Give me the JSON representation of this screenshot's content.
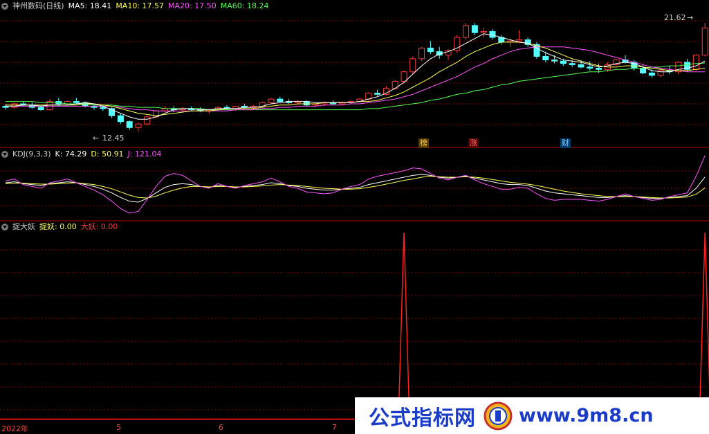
{
  "header": {
    "stock_name": "神州数码(日线)",
    "ma5_label": "MA5: 18.41",
    "ma10_label": "MA10: 17.57",
    "ma20_label": "MA20: 17.50",
    "ma60_label": "MA60: 18.24"
  },
  "kdj_header": {
    "name": "KDJ(9,3,3)",
    "k_label": "K: 74.29",
    "d_label": "D: 50.91",
    "j_label": "J: 121.04"
  },
  "ind_header": {
    "name": "捉大妖",
    "v1_label": "捉妖: 0.00",
    "v2_label": "大妖: 0.00"
  },
  "annotations": {
    "high_label": "21.62",
    "low_label": "12.45",
    "tag_bang": "榜",
    "tag_zhang": "涨",
    "tag_cai": "财"
  },
  "x_axis": {
    "labels": [
      "2022年",
      "5",
      "6",
      "7"
    ]
  },
  "watermark": {
    "text1": "公式指标网",
    "text2": "www.9m8.cn"
  },
  "colors": {
    "up": "#ff3c3c",
    "down": "#54ffff",
    "ma5": "#ffffff",
    "ma10": "#ffff54",
    "ma20": "#ff54ff",
    "ma60": "#54ff54",
    "grid": "#8b0000",
    "sep": "#c00000",
    "spike": "#ff2020"
  },
  "chart_data": [
    {
      "type": "candlestick",
      "ylim": [
        12.0,
        22.5
      ],
      "note_high": 21.62,
      "note_low": 12.45,
      "ohlc": [
        [
          14.6,
          14.8,
          14.3,
          14.5
        ],
        [
          14.5,
          14.9,
          14.4,
          14.8
        ],
        [
          14.8,
          15.0,
          14.6,
          14.7
        ],
        [
          14.7,
          14.9,
          14.4,
          14.5
        ],
        [
          14.5,
          14.7,
          14.2,
          14.3
        ],
        [
          14.3,
          15.2,
          14.2,
          15.0
        ],
        [
          15.0,
          15.3,
          14.6,
          14.8
        ],
        [
          14.8,
          15.1,
          14.6,
          15.0
        ],
        [
          15.0,
          15.3,
          14.8,
          14.9
        ],
        [
          14.9,
          15.0,
          14.5,
          14.6
        ],
        [
          14.6,
          14.8,
          14.3,
          14.5
        ],
        [
          14.5,
          14.7,
          14.2,
          14.4
        ],
        [
          14.4,
          14.5,
          13.6,
          13.8
        ],
        [
          13.8,
          14.0,
          13.1,
          13.3
        ],
        [
          13.3,
          13.4,
          12.6,
          12.8
        ],
        [
          12.8,
          13.2,
          12.45,
          13.1
        ],
        [
          13.1,
          13.8,
          13.0,
          13.7
        ],
        [
          13.7,
          14.3,
          13.6,
          14.2
        ],
        [
          14.2,
          14.6,
          14.0,
          14.4
        ],
        [
          14.4,
          14.6,
          14.1,
          14.3
        ],
        [
          14.3,
          14.5,
          14.1,
          14.4
        ],
        [
          14.4,
          14.6,
          14.2,
          14.3
        ],
        [
          14.3,
          14.5,
          14.1,
          14.2
        ],
        [
          14.2,
          14.4,
          14.0,
          14.3
        ],
        [
          14.3,
          14.6,
          14.2,
          14.5
        ],
        [
          14.5,
          14.7,
          14.3,
          14.4
        ],
        [
          14.4,
          14.6,
          14.2,
          14.6
        ],
        [
          14.6,
          14.8,
          14.4,
          14.5
        ],
        [
          14.5,
          14.7,
          14.3,
          14.6
        ],
        [
          14.6,
          15.0,
          14.5,
          14.9
        ],
        [
          14.9,
          15.3,
          14.8,
          15.2
        ],
        [
          15.2,
          15.4,
          14.9,
          15.0
        ],
        [
          15.0,
          15.2,
          14.8,
          14.9
        ],
        [
          14.9,
          15.1,
          14.7,
          15.0
        ],
        [
          15.0,
          15.1,
          14.6,
          14.7
        ],
        [
          14.7,
          14.9,
          14.5,
          14.8
        ],
        [
          14.8,
          15.0,
          14.6,
          14.9
        ],
        [
          14.9,
          15.1,
          14.7,
          14.8
        ],
        [
          14.8,
          15.0,
          14.7,
          14.9
        ],
        [
          14.9,
          15.1,
          14.8,
          15.0
        ],
        [
          15.0,
          15.3,
          14.9,
          15.2
        ],
        [
          15.2,
          15.8,
          15.1,
          15.7
        ],
        [
          15.7,
          16.0,
          15.5,
          15.6
        ],
        [
          15.6,
          16.3,
          15.5,
          16.1
        ],
        [
          16.1,
          16.8,
          16.0,
          16.7
        ],
        [
          16.7,
          17.6,
          16.5,
          17.5
        ],
        [
          17.5,
          18.8,
          17.3,
          18.6
        ],
        [
          18.6,
          19.6,
          18.4,
          19.5
        ],
        [
          19.5,
          20.1,
          19.0,
          19.2
        ],
        [
          19.2,
          19.6,
          18.6,
          18.9
        ],
        [
          18.9,
          19.4,
          18.5,
          19.3
        ],
        [
          19.3,
          20.6,
          19.1,
          20.4
        ],
        [
          20.4,
          21.6,
          20.2,
          21.4
        ],
        [
          21.4,
          21.6,
          20.6,
          20.8
        ],
        [
          20.8,
          21.2,
          20.4,
          20.9
        ],
        [
          20.9,
          21.1,
          20.2,
          20.4
        ],
        [
          20.4,
          20.6,
          19.8,
          20.0
        ],
        [
          20.0,
          20.3,
          19.6,
          20.1
        ],
        [
          20.1,
          21.0,
          19.9,
          20.2
        ],
        [
          20.2,
          20.4,
          19.6,
          19.8
        ],
        [
          19.8,
          20.0,
          18.6,
          18.8
        ],
        [
          18.8,
          19.2,
          18.3,
          18.5
        ],
        [
          18.5,
          18.9,
          18.2,
          18.4
        ],
        [
          18.4,
          18.6,
          18.0,
          18.2
        ],
        [
          18.2,
          18.5,
          17.9,
          18.1
        ],
        [
          18.1,
          18.5,
          17.8,
          17.9
        ],
        [
          17.9,
          18.4,
          17.6,
          17.8
        ],
        [
          17.8,
          18.2,
          17.4,
          17.7
        ],
        [
          17.7,
          18.3,
          17.5,
          18.1
        ],
        [
          18.1,
          18.6,
          18.0,
          18.5
        ],
        [
          18.5,
          18.9,
          18.2,
          18.3
        ],
        [
          18.3,
          18.5,
          17.6,
          17.8
        ],
        [
          17.8,
          18.1,
          17.3,
          17.4
        ],
        [
          17.4,
          17.7,
          17.0,
          17.2
        ],
        [
          17.2,
          17.8,
          17.0,
          17.6
        ],
        [
          17.6,
          18.0,
          17.3,
          17.5
        ],
        [
          17.5,
          18.4,
          17.3,
          18.3
        ],
        [
          18.3,
          18.6,
          17.5,
          17.7
        ],
        [
          17.7,
          19.0,
          17.6,
          18.9
        ],
        [
          18.9,
          21.62,
          18.8,
          21.2
        ]
      ],
      "ma5": [
        14.6,
        14.6,
        14.7,
        14.7,
        14.6,
        14.7,
        14.7,
        14.7,
        14.8,
        14.9,
        14.8,
        14.6,
        14.3,
        14.0,
        13.7,
        13.5,
        13.5,
        13.7,
        14.0,
        14.3,
        14.4,
        14.4,
        14.3,
        14.3,
        14.4,
        14.4,
        14.4,
        14.5,
        14.5,
        14.6,
        14.8,
        14.9,
        15.0,
        15.0,
        15.0,
        14.9,
        14.9,
        14.9,
        14.9,
        14.9,
        15.0,
        15.2,
        15.4,
        15.7,
        16.1,
        16.6,
        17.3,
        18.0,
        18.6,
        19.0,
        19.2,
        19.5,
        19.9,
        20.3,
        20.7,
        20.6,
        20.4,
        20.2,
        20.0,
        19.9,
        19.5,
        19.1,
        18.8,
        18.5,
        18.4,
        18.3,
        18.1,
        17.9,
        18.0,
        18.2,
        18.3,
        18.2,
        17.9,
        17.6,
        17.5,
        17.5,
        17.7,
        17.8,
        18.0,
        18.4
      ],
      "ma10": [
        14.7,
        14.7,
        14.7,
        14.7,
        14.7,
        14.7,
        14.7,
        14.7,
        14.7,
        14.8,
        14.8,
        14.7,
        14.6,
        14.4,
        14.2,
        14.0,
        13.9,
        13.8,
        13.9,
        14.0,
        14.1,
        14.2,
        14.2,
        14.2,
        14.3,
        14.4,
        14.4,
        14.4,
        14.4,
        14.5,
        14.6,
        14.7,
        14.7,
        14.8,
        14.8,
        14.8,
        14.9,
        14.9,
        14.9,
        14.9,
        15.0,
        15.0,
        15.1,
        15.3,
        15.5,
        15.8,
        16.2,
        16.6,
        17.0,
        17.5,
        17.9,
        18.3,
        18.8,
        19.2,
        19.5,
        19.8,
        20.0,
        20.0,
        20.0,
        19.9,
        19.7,
        19.5,
        19.2,
        18.9,
        18.6,
        18.4,
        18.2,
        18.0,
        17.9,
        17.9,
        18.0,
        18.0,
        17.9,
        17.8,
        17.7,
        17.6,
        17.6,
        17.6,
        17.7,
        17.8
      ],
      "ma20": [
        14.6,
        14.6,
        14.6,
        14.6,
        14.6,
        14.6,
        14.6,
        14.6,
        14.6,
        14.6,
        14.6,
        14.6,
        14.6,
        14.5,
        14.4,
        14.3,
        14.3,
        14.2,
        14.2,
        14.2,
        14.2,
        14.2,
        14.2,
        14.2,
        14.2,
        14.2,
        14.3,
        14.3,
        14.3,
        14.4,
        14.4,
        14.5,
        14.5,
        14.6,
        14.6,
        14.6,
        14.7,
        14.7,
        14.7,
        14.8,
        14.8,
        14.9,
        15.0,
        15.1,
        15.2,
        15.4,
        15.6,
        15.9,
        16.2,
        16.5,
        16.8,
        17.1,
        17.5,
        17.9,
        18.2,
        18.6,
        18.9,
        19.2,
        19.4,
        19.5,
        19.6,
        19.6,
        19.6,
        19.6,
        19.5,
        19.4,
        19.3,
        19.1,
        18.9,
        18.7,
        18.5,
        18.3,
        18.1,
        17.9,
        17.8,
        17.7,
        17.6,
        17.5,
        17.5,
        17.5
      ],
      "ma60": [
        15.0,
        15.0,
        15.0,
        15.0,
        14.9,
        14.9,
        14.9,
        14.8,
        14.8,
        14.8,
        14.7,
        14.7,
        14.7,
        14.6,
        14.6,
        14.5,
        14.5,
        14.5,
        14.4,
        14.4,
        14.4,
        14.4,
        14.4,
        14.3,
        14.3,
        14.3,
        14.3,
        14.3,
        14.3,
        14.3,
        14.3,
        14.3,
        14.3,
        14.3,
        14.3,
        14.3,
        14.3,
        14.3,
        14.3,
        14.3,
        14.3,
        14.4,
        14.4,
        14.5,
        14.6,
        14.7,
        14.8,
        14.9,
        15.1,
        15.2,
        15.4,
        15.6,
        15.7,
        15.9,
        16.0,
        16.2,
        16.4,
        16.5,
        16.7,
        16.8,
        16.9,
        17.0,
        17.1,
        17.2,
        17.3,
        17.4,
        17.5,
        17.5,
        17.6,
        17.7,
        17.7,
        17.8,
        17.8,
        17.9,
        17.9,
        18.0,
        18.0,
        18.1,
        18.2,
        18.24
      ]
    },
    {
      "type": "line",
      "ylim": [
        -10,
        110
      ],
      "series": [
        {
          "name": "K",
          "values": [
            62,
            64,
            60,
            58,
            56,
            60,
            62,
            64,
            62,
            58,
            54,
            48,
            40,
            30,
            22,
            20,
            28,
            40,
            52,
            58,
            60,
            58,
            54,
            52,
            56,
            54,
            52,
            54,
            56,
            58,
            62,
            60,
            56,
            54,
            50,
            48,
            46,
            46,
            48,
            50,
            52,
            58,
            62,
            66,
            70,
            74,
            78,
            80,
            78,
            74,
            72,
            74,
            76,
            72,
            68,
            64,
            60,
            58,
            58,
            56,
            50,
            44,
            40,
            38,
            36,
            34,
            32,
            30,
            30,
            32,
            34,
            32,
            30,
            28,
            28,
            30,
            32,
            34,
            50,
            74.29
          ]
        },
        {
          "name": "D",
          "values": [
            60,
            61,
            61,
            60,
            59,
            59,
            60,
            61,
            62,
            60,
            58,
            54,
            49,
            42,
            35,
            30,
            29,
            33,
            40,
            46,
            51,
            54,
            54,
            53,
            54,
            54,
            53,
            53,
            54,
            55,
            57,
            58,
            57,
            56,
            54,
            52,
            50,
            49,
            48,
            48,
            49,
            52,
            55,
            59,
            63,
            67,
            70,
            74,
            76,
            75,
            74,
            74,
            75,
            74,
            72,
            69,
            66,
            63,
            61,
            59,
            56,
            52,
            48,
            44,
            41,
            38,
            36,
            34,
            32,
            32,
            32,
            32,
            31,
            30,
            29,
            29,
            30,
            31,
            37,
            50.91
          ]
        },
        {
          "name": "J",
          "values": [
            66,
            70,
            58,
            54,
            50,
            62,
            66,
            70,
            62,
            54,
            46,
            36,
            22,
            6,
            -4,
            0,
            26,
            54,
            76,
            82,
            78,
            66,
            54,
            50,
            60,
            54,
            50,
            56,
            60,
            64,
            72,
            64,
            54,
            50,
            42,
            40,
            38,
            40,
            48,
            54,
            58,
            70,
            76,
            80,
            84,
            88,
            94,
            92,
            82,
            72,
            68,
            74,
            78,
            68,
            60,
            54,
            48,
            48,
            52,
            50,
            38,
            28,
            24,
            26,
            26,
            26,
            24,
            22,
            26,
            32,
            38,
            32,
            28,
            24,
            26,
            32,
            36,
            40,
            76,
            121.04
          ]
        }
      ]
    },
    {
      "type": "line",
      "ylim": [
        0,
        100
      ],
      "series": [
        {
          "name": "捉妖",
          "values": [
            0,
            0,
            0,
            0,
            0,
            0,
            0,
            0,
            0,
            0,
            0,
            0,
            0,
            0,
            0,
            0,
            0,
            0,
            0,
            0,
            0,
            0,
            0,
            0,
            0,
            0,
            0,
            0,
            0,
            0,
            0,
            0,
            0,
            0,
            0,
            0,
            0,
            0,
            0,
            0,
            0,
            0,
            0,
            0,
            0,
            100,
            0,
            0,
            0,
            0,
            0,
            0,
            0,
            0,
            0,
            0,
            0,
            0,
            0,
            0,
            0,
            0,
            0,
            0,
            0,
            0,
            0,
            0,
            0,
            0,
            0,
            0,
            0,
            0,
            0,
            0,
            0,
            0,
            0,
            100
          ]
        },
        {
          "name": "大妖",
          "values": [
            0,
            0,
            0,
            0,
            0,
            0,
            0,
            0,
            0,
            0,
            0,
            0,
            0,
            0,
            0,
            0,
            0,
            0,
            0,
            0,
            0,
            0,
            0,
            0,
            0,
            0,
            0,
            0,
            0,
            0,
            0,
            0,
            0,
            0,
            0,
            0,
            0,
            0,
            0,
            0,
            0,
            0,
            0,
            0,
            0,
            0,
            0,
            0,
            0,
            0,
            0,
            0,
            0,
            0,
            0,
            0,
            0,
            0,
            0,
            0,
            0,
            0,
            0,
            0,
            0,
            0,
            0,
            0,
            0,
            0,
            0,
            0,
            0,
            0,
            0,
            0,
            0,
            0,
            0,
            0
          ]
        }
      ]
    }
  ]
}
